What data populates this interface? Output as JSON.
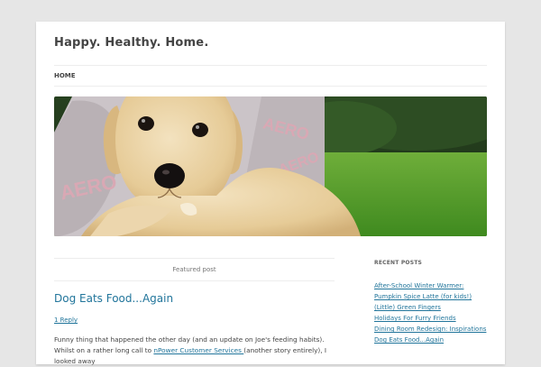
{
  "site": {
    "title": "Happy. Healthy. Home."
  },
  "nav": {
    "items": [
      {
        "label": "HOME"
      }
    ]
  },
  "header_image": {
    "subject": "puppy"
  },
  "featured_post": {
    "label": "Featured post",
    "title": "Dog Eats Food...Again",
    "reply": "1 Reply",
    "excerpt_start": "Funny thing that happened the other day (and an update on Joe's feeding habits). Whilst on a rather long call to ",
    "excerpt_link": "nPower Customer Services ",
    "excerpt_end": "(another story entirely), I looked away"
  },
  "sidebar": {
    "recent_posts": {
      "title": "RECENT POSTS",
      "items": [
        "After-School Winter Warmer: Pumpkin Spice Latte (for kids!)",
        "(Little) Green Fingers",
        "Holidays For Furry Friends",
        "Dining Room Redesign: Inspirations",
        "Dog Eats Food...Again"
      ]
    }
  },
  "colors": {
    "link": "#21759b",
    "text": "#444444",
    "background": "#e6e6e6"
  }
}
